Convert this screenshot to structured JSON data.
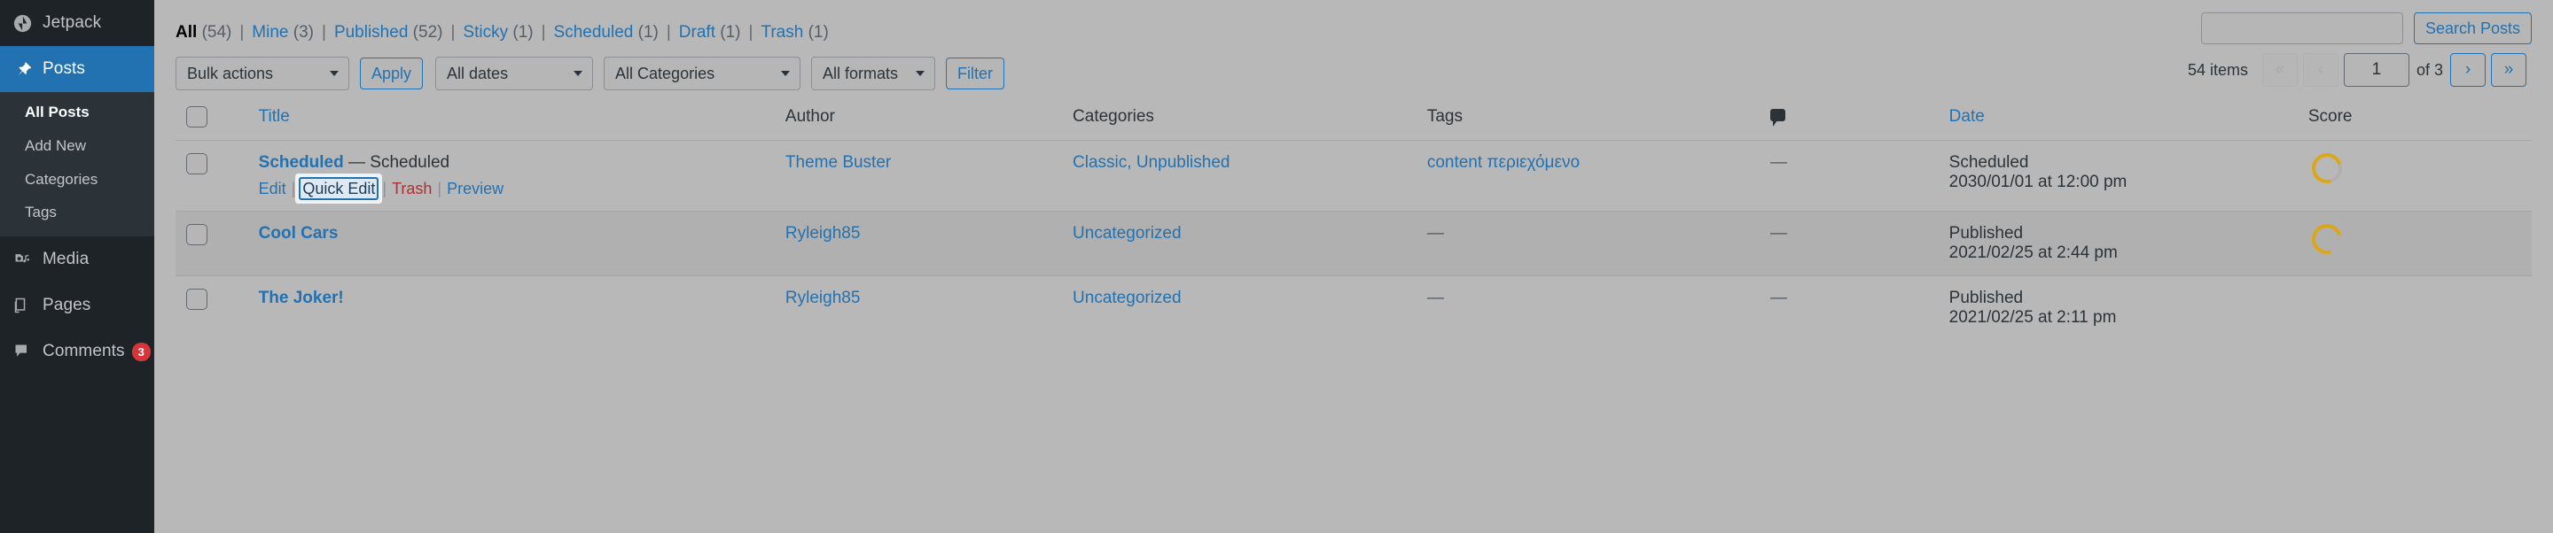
{
  "sidebar": {
    "items": [
      {
        "label": "Jetpack",
        "icon": "jetpack-icon",
        "current": false,
        "badge": ""
      },
      {
        "label": "Posts",
        "icon": "pin-icon",
        "current": true,
        "badge": ""
      },
      {
        "label": "Media",
        "icon": "media-icon",
        "current": false,
        "badge": ""
      },
      {
        "label": "Pages",
        "icon": "pages-icon",
        "current": false,
        "badge": ""
      },
      {
        "label": "Comments",
        "icon": "comments-icon",
        "current": false,
        "badge": "3"
      }
    ],
    "submenu": [
      {
        "label": "All Posts",
        "current": true
      },
      {
        "label": "Add New",
        "current": false
      },
      {
        "label": "Categories",
        "current": false
      },
      {
        "label": "Tags",
        "current": false
      }
    ]
  },
  "views": [
    {
      "label": "All",
      "count": "(54)",
      "current": true
    },
    {
      "label": "Mine",
      "count": "(3)",
      "current": false
    },
    {
      "label": "Published",
      "count": "(52)",
      "current": false
    },
    {
      "label": "Sticky",
      "count": "(1)",
      "current": false
    },
    {
      "label": "Scheduled",
      "count": "(1)",
      "current": false
    },
    {
      "label": "Draft",
      "count": "(1)",
      "current": false
    },
    {
      "label": "Trash",
      "count": "(1)",
      "current": false
    }
  ],
  "search": {
    "value": "",
    "placeholder": "",
    "button_label": "Search Posts"
  },
  "toolbar": {
    "bulk_actions_label": "Bulk actions",
    "apply_label": "Apply",
    "all_dates_label": "All dates",
    "all_categories_label": "All Categories",
    "all_formats_label": "All formats",
    "filter_label": "Filter"
  },
  "pagination": {
    "items_text": "54 items",
    "first_label": "«",
    "prev_label": "‹",
    "current_page": "1",
    "of_text": "of 3",
    "next_label": "›",
    "last_label": "»"
  },
  "table": {
    "headers": {
      "cb": "",
      "title": "Title",
      "author": "Author",
      "categories": "Categories",
      "tags": "Tags",
      "comments": "comments-icon",
      "date": "Date",
      "score": "Score"
    },
    "rows": [
      {
        "title": "Scheduled",
        "state": " — Scheduled",
        "author": "Theme Buster",
        "categories": "Classic, Unpublished",
        "tags": "content περιεχόμενο",
        "comments": "—",
        "date_status": "Scheduled",
        "date_value": "2030/01/01 at 12:00 pm",
        "score": "donut",
        "actions": [
          {
            "label": "Edit",
            "kind": "link",
            "focused": false
          },
          {
            "label": "Quick Edit",
            "kind": "link",
            "focused": true
          },
          {
            "label": "Trash",
            "kind": "trash",
            "focused": false
          },
          {
            "label": "Preview",
            "kind": "link",
            "focused": false
          }
        ]
      },
      {
        "title": "Cool Cars",
        "state": "",
        "author": "Ryleigh85",
        "categories": "Uncategorized",
        "tags": "—",
        "comments": "—",
        "date_status": "Published",
        "date_value": "2021/02/25 at 2:44 pm",
        "score": "donut",
        "actions": []
      },
      {
        "title": "The Joker!",
        "state": "",
        "author": "Ryleigh85",
        "categories": "Uncategorized",
        "tags": "—",
        "comments": "—",
        "date_status": "Published",
        "date_value": "2021/02/25 at 2:11 pm",
        "score": "",
        "actions": []
      }
    ]
  },
  "colors": {
    "accent": "#2271b1",
    "sidebar_bg": "#1d2327",
    "trash": "#b32d2e",
    "score_ring": "#dba617",
    "badge": "#d63638"
  }
}
